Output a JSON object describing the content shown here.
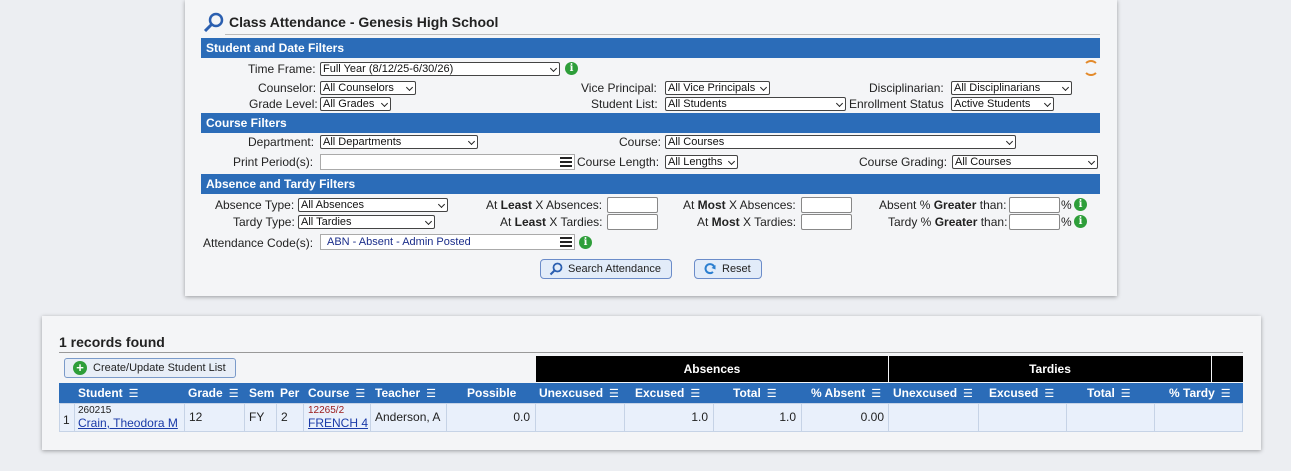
{
  "page": {
    "title": "Class Attendance - Genesis High School"
  },
  "sections": {
    "student_date": "Student and Date Filters",
    "course": "Course Filters",
    "absence_tardy": "Absence and Tardy Filters"
  },
  "filters": {
    "time_frame": {
      "label": "Time Frame:",
      "value": "Full Year (8/12/25-6/30/26)"
    },
    "counselor": {
      "label": "Counselor:",
      "value": "All Counselors"
    },
    "vice_principal": {
      "label": "Vice Principal:",
      "value": "All Vice Principals"
    },
    "disciplinarian": {
      "label": "Disciplinarian:",
      "value": "All Disciplinarians"
    },
    "grade_level": {
      "label": "Grade Level:",
      "value": "All Grades"
    },
    "student_list": {
      "label": "Student List:",
      "value": "All Students"
    },
    "enrollment_status": {
      "label": "Enrollment Status",
      "value": "Active Students"
    },
    "department": {
      "label": "Department:",
      "value": "All Departments"
    },
    "course": {
      "label": "Course:",
      "value": "All Courses"
    },
    "print_periods": {
      "label": "Print Period(s):",
      "value": ""
    },
    "course_length": {
      "label": "Course Length:",
      "value": "All Lengths"
    },
    "course_grading": {
      "label": "Course Grading:",
      "value": "All Courses"
    },
    "absence_type": {
      "label": "Absence Type:",
      "value": "All Absences"
    },
    "tardy_type": {
      "label": "Tardy Type:",
      "value": "All Tardies"
    },
    "attendance_codes": {
      "label": "Attendance Code(s):",
      "value": "ABN - Absent - Admin Posted"
    },
    "at_least_absences": {
      "pre": "At ",
      "bold": "Least",
      "post": " X Absences:"
    },
    "at_least_tardies": {
      "pre": "At ",
      "bold": "Least",
      "post": " X Tardies:"
    },
    "at_most_absences": {
      "pre": "At ",
      "bold": "Most",
      "post": " X Absences:"
    },
    "at_most_tardies": {
      "pre": "At ",
      "bold": "Most",
      "post": " X Tardies:"
    },
    "absent_pct": {
      "pre": "Absent % ",
      "bold": "Greater",
      "post": " than:"
    },
    "tardy_pct": {
      "pre": "Tardy % ",
      "bold": "Greater",
      "post": " than:"
    },
    "pct_sign": "%"
  },
  "buttons": {
    "search": "Search Attendance",
    "reset": "Reset",
    "create_list": "Create/Update Student List"
  },
  "results": {
    "count_text": "1 records found",
    "group_absences": "Absences",
    "group_tardies": "Tardies",
    "columns": [
      "Student",
      "Grade",
      "Sem",
      "Per",
      "Course",
      "Teacher",
      "Possible",
      "Unexcused",
      "Excused",
      "Total",
      "% Absent",
      "Unexcused",
      "Excused",
      "Total",
      "% Tardy"
    ],
    "rows": [
      {
        "num": "1",
        "student_id": "260215",
        "student_name": "Crain, Theodora M",
        "grade": "12",
        "sem": "FY",
        "per": "2",
        "course_code": "12265/2",
        "course_name": "FRENCH 4",
        "teacher": "Anderson, A",
        "possible": "0.0",
        "abs_unexcused": "",
        "abs_excused": "1.0",
        "abs_total": "1.0",
        "pct_absent": "0.00",
        "tar_unexcused": "",
        "tar_excused": "",
        "tar_total": "",
        "pct_tardy": ""
      }
    ]
  },
  "colors": {
    "section_bar": "#2b6cb8",
    "info_icon": "#2e9e3a",
    "refresh_icon": "#e38a2b"
  }
}
